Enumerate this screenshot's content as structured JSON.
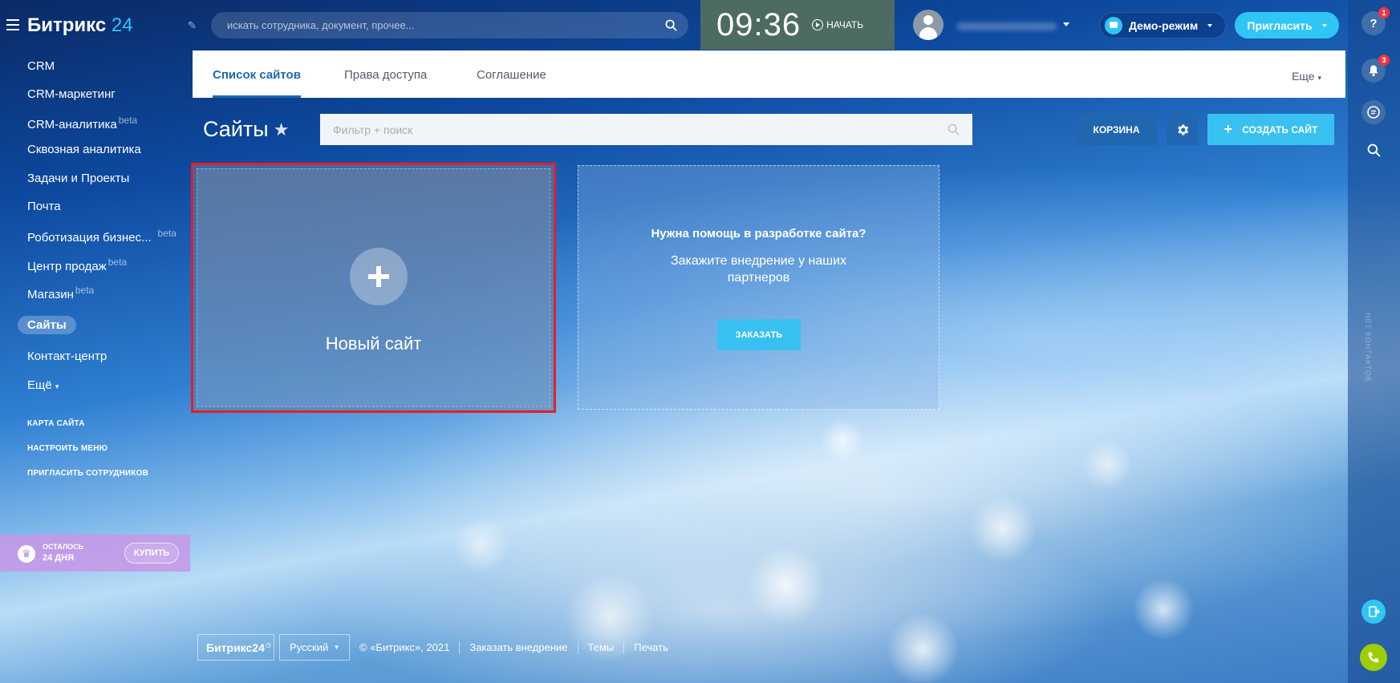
{
  "header": {
    "logo_text": "Битрикс",
    "logo_number": "24",
    "search_placeholder": "искать сотрудника, документ, прочее...",
    "time": "09:36",
    "start_label": "НАЧАТЬ",
    "demo_label": "Демо-режим",
    "invite_label": "Пригласить"
  },
  "rail": {
    "help_badge": "1",
    "bell_badge": "3",
    "vertical_text": "НЕТ КОНТАКТОВ"
  },
  "sidebar": {
    "items": [
      {
        "label": "CRM",
        "beta": ""
      },
      {
        "label": "CRM-маркетинг",
        "beta": ""
      },
      {
        "label": "CRM-аналитика",
        "beta": "beta"
      },
      {
        "label": "Сквозная аналитика",
        "beta": ""
      },
      {
        "label": "Задачи и Проекты",
        "beta": ""
      },
      {
        "label": "Почта",
        "beta": ""
      },
      {
        "label": "Роботизация бизнес...",
        "beta": "beta"
      },
      {
        "label": "Центр продаж",
        "beta": "beta"
      },
      {
        "label": "Магазин",
        "beta": "beta"
      },
      {
        "label": "Сайты",
        "beta": ""
      },
      {
        "label": "Контакт-центр",
        "beta": ""
      },
      {
        "label": "Ещё",
        "beta": ""
      }
    ],
    "links": [
      "КАРТА САЙТА",
      "НАСТРОИТЬ МЕНЮ",
      "ПРИГЛАСИТЬ СОТРУДНИКОВ"
    ],
    "trial": {
      "left_label": "ОСТАЛОСЬ",
      "days": "24 ДНЯ",
      "buy_label": "КУПИТЬ"
    }
  },
  "tabs": {
    "items": [
      "Список сайтов",
      "Права доступа",
      "Соглашение"
    ],
    "more_label": "Еще"
  },
  "toolbar": {
    "title": "Сайты",
    "filter_placeholder": "Фильтр + поиск",
    "cart_label": "КОРЗИНА",
    "create_label": "СОЗДАТЬ САЙТ"
  },
  "cards": {
    "new_site_label": "Новый сайт",
    "help_title": "Нужна помощь в разработке сайта?",
    "help_subtitle": "Закажите внедрение у наших партнеров",
    "order_label": "ЗАКАЗАТЬ"
  },
  "footer": {
    "brand": "Битрикс24",
    "lang": "Русский",
    "copyright": "© «Битрикс», 2021",
    "links": [
      "Заказать внедрение",
      "Темы",
      "Печать"
    ]
  },
  "colors": {
    "accent": "#2fc6f6",
    "primary_blue": "#2067b0",
    "highlight_red": "#e32027",
    "trial_purple": "#c896e6",
    "phone_green": "#9dcf00"
  }
}
